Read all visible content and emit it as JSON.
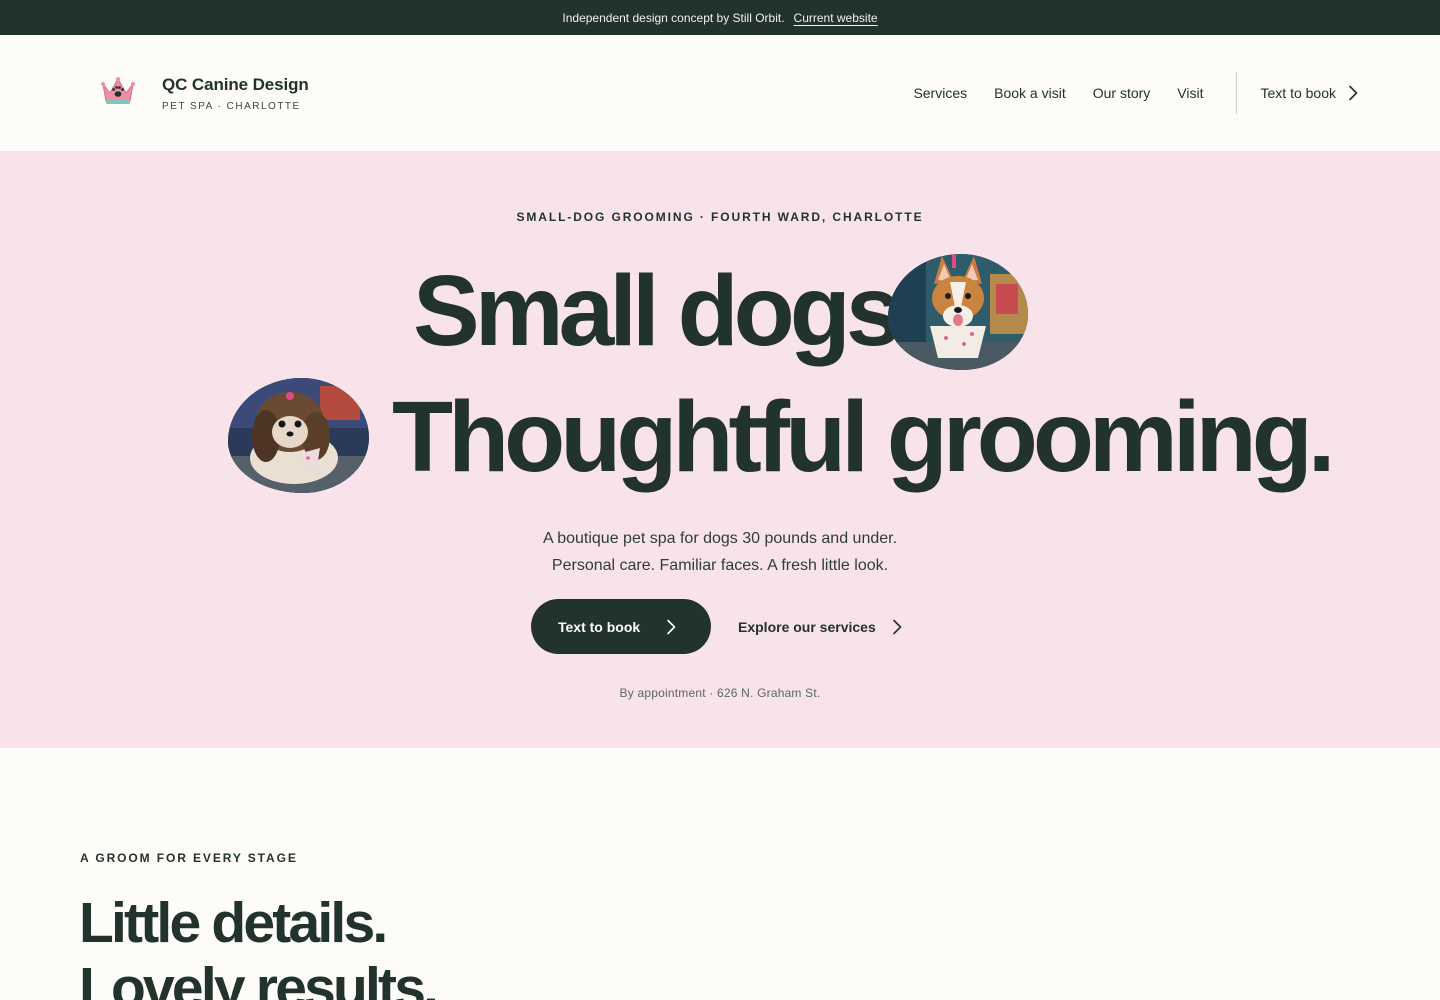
{
  "banner": {
    "text": "Independent design concept by Still Orbit.",
    "link": "Current website"
  },
  "brand": {
    "name": "QC Canine Design",
    "tagline": "PET SPA · CHARLOTTE",
    "logo_icon": "crown-paw-icon"
  },
  "nav": {
    "items": [
      "Services",
      "Book a visit",
      "Our story",
      "Visit"
    ],
    "cta": "Text to book",
    "cta_icon": "chevron-right-icon"
  },
  "hero": {
    "eyebrow": "SMALL-DOG GROOMING · FOURTH WARD, CHARLOTTE",
    "line1": "Small dogs.",
    "line2": "Thoughtful grooming.",
    "lead1": "A boutique pet spa for dogs 30 pounds and under.",
    "lead2": "Personal care. Familiar faces. A fresh little look.",
    "primary_cta": "Text to book",
    "secondary_cta": "Explore our services",
    "meta": "By appointment · 626 N. Graham St."
  },
  "section": {
    "eyebrow": "A GROOM FOR EVERY STAGE",
    "title1": "Little details.",
    "title2": "Lovely results."
  },
  "colors": {
    "dark": "#22332d",
    "hero_bg": "#f8e3ea",
    "page_bg": "#fdfcf9"
  }
}
